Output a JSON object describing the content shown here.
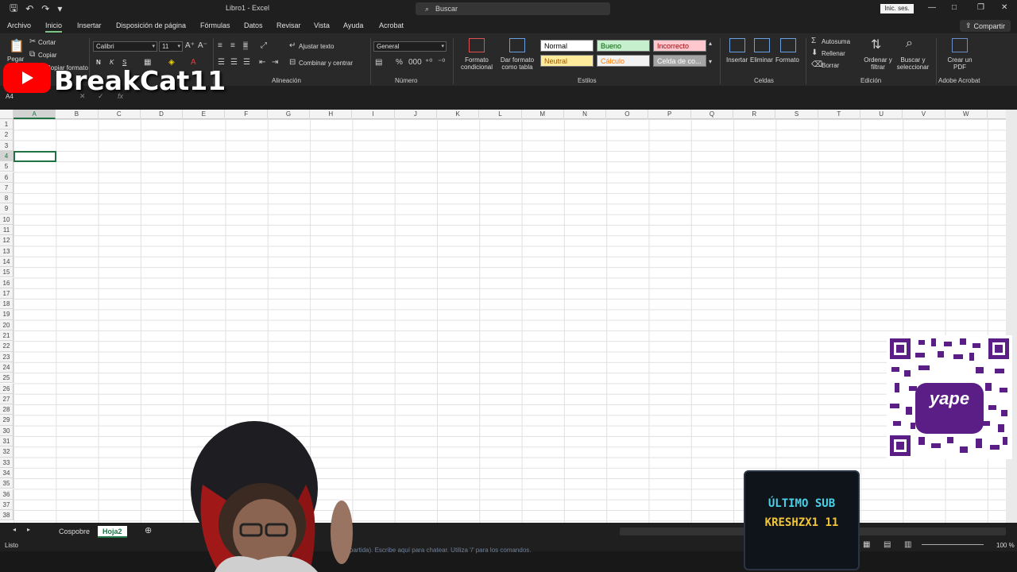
{
  "window": {
    "title": "Libro1  -  Excel",
    "search_placeholder": "Buscar",
    "sign_in": "Inic. ses.",
    "share": "Compartir"
  },
  "menu": [
    "Archivo",
    "Inicio",
    "Insertar",
    "Disposición de página",
    "Fórmulas",
    "Datos",
    "Revisar",
    "Vista",
    "Ayuda",
    "Acrobat"
  ],
  "menu_active": "Inicio",
  "ribbon": {
    "clipboard": {
      "paste": "Pegar",
      "cut": "Cortar",
      "copy": "Copiar",
      "format_painter": "Copiar formato"
    },
    "font": {
      "name": "Calibri",
      "size": "11",
      "bold": "N",
      "italic": "K",
      "underline": "S"
    },
    "alignment": {
      "wrap": "Ajustar texto",
      "merge": "Combinar y centrar",
      "label": "Alineación"
    },
    "number": {
      "format": "General",
      "label": "Número"
    },
    "styles": {
      "conditional": "Formato condicional",
      "as_table": "Dar formato como tabla",
      "cells": [
        {
          "label": "Normal",
          "bg": "#ffffff",
          "fg": "#000000"
        },
        {
          "label": "Bueno",
          "bg": "#c6efce",
          "fg": "#006100"
        },
        {
          "label": "Incorrecto",
          "bg": "#ffc7ce",
          "fg": "#9c0006"
        },
        {
          "label": "Neutral",
          "bg": "#ffeb9c",
          "fg": "#9c5700"
        },
        {
          "label": "Cálculo",
          "bg": "#f2f2f2",
          "fg": "#fa7d00"
        },
        {
          "label": "Celda de co...",
          "bg": "#a5a5a5",
          "fg": "#ffffff"
        }
      ],
      "label": "Estilos"
    },
    "cells_group": {
      "insert": "Insertar",
      "delete": "Eliminar",
      "format": "Formato",
      "label": "Celdas"
    },
    "editing": {
      "autosum": "Autosuma",
      "fill": "Rellenar",
      "clear": "Borrar",
      "sort": "Ordenar y filtrar",
      "find": "Buscar y seleccionar",
      "label": "Edición"
    },
    "acrobat": {
      "create_pdf": "Crear un PDF",
      "label": "Adobe Acrobat"
    }
  },
  "formula_bar": {
    "name_box": "A4",
    "fx": "fx"
  },
  "columns": [
    "A",
    "B",
    "C",
    "D",
    "E",
    "F",
    "G",
    "H",
    "I",
    "J",
    "K",
    "L",
    "M",
    "N",
    "O",
    "P",
    "Q",
    "R",
    "S",
    "T",
    "U",
    "V",
    "W"
  ],
  "selected_column": "A",
  "rows": [
    "1",
    "2",
    "3",
    "4",
    "5",
    "6",
    "7",
    "8",
    "9",
    "10",
    "11",
    "12",
    "13",
    "14",
    "15",
    "16",
    "17",
    "18",
    "19",
    "20",
    "21",
    "22",
    "23",
    "24",
    "25",
    "26",
    "27",
    "28",
    "29",
    "30",
    "31",
    "32",
    "33",
    "34",
    "35",
    "36",
    "37",
    "38"
  ],
  "selected_row": "4",
  "sheets": [
    "Cospobre",
    "Hoja2"
  ],
  "active_sheet": "Hoja2",
  "status": {
    "ready": "Listo",
    "zoom": "100 %"
  },
  "chat_hint": "partida). Escribe aquí para chatear. Utiliza '/' para los comandos.",
  "overlay": {
    "channel": "BreakCat11",
    "qr_label": "yape",
    "last_sub_title": "ÚLTIMO SUB",
    "last_sub_name": "KRESHZX1 11"
  }
}
